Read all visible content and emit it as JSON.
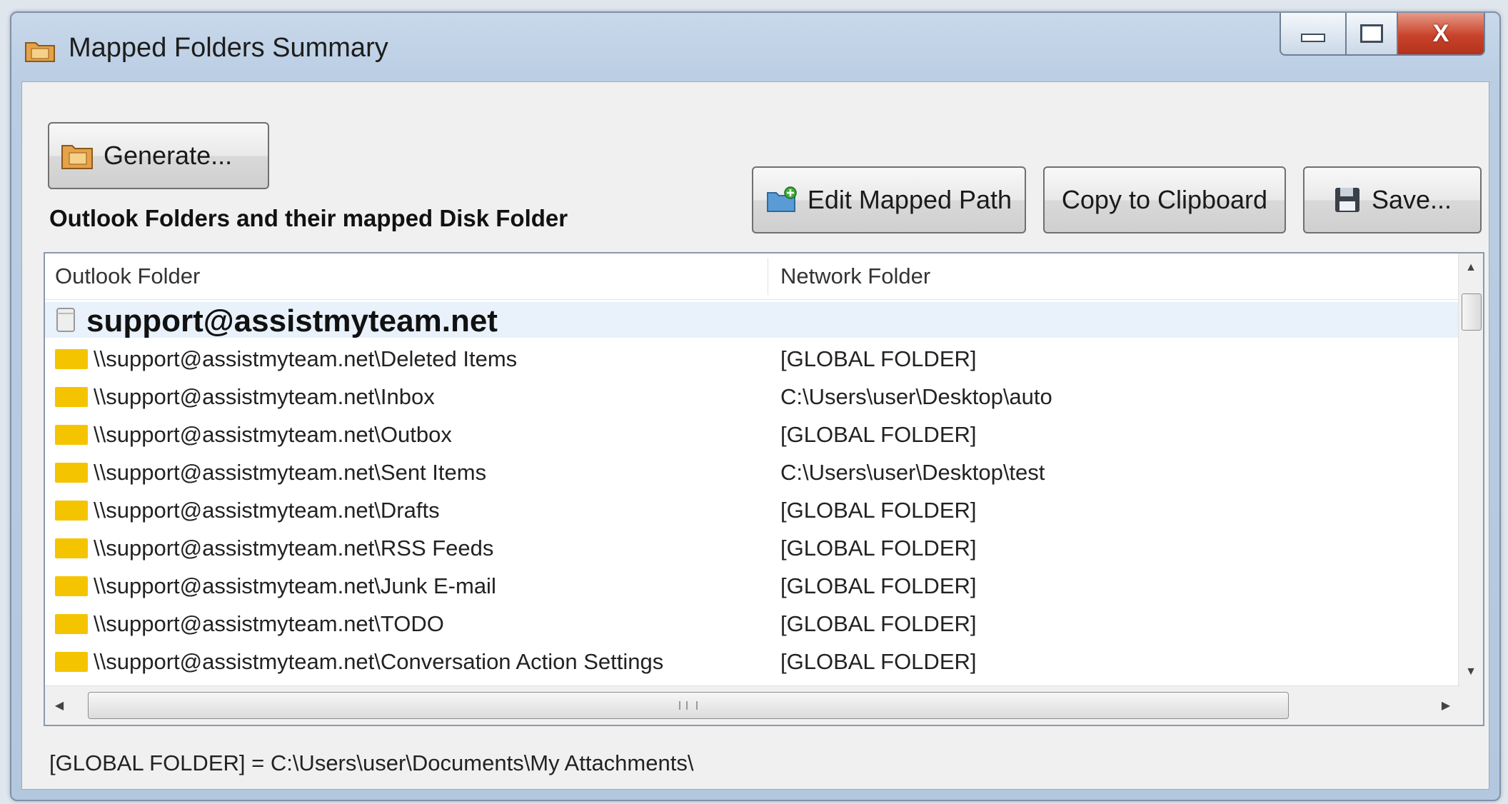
{
  "window": {
    "title": "Mapped Folders Summary",
    "icons": {
      "title": "folder-icon",
      "close": "close-icon",
      "minimize": "minimize-icon",
      "maximize": "maximize-icon"
    },
    "close_label": "X"
  },
  "toolbar": {
    "generate_label": "Generate...",
    "generate_icon": "folder-icon",
    "edit_label": "Edit Mapped Path",
    "edit_icon": "folder-add-icon",
    "copy_label": "Copy to Clipboard",
    "save_label": "Save...",
    "save_icon": "floppy-disk-icon"
  },
  "section_label": "Outlook Folders and their mapped Disk Folder",
  "list": {
    "columns": [
      "Outlook Folder",
      "Network Folder"
    ],
    "group": "support@assistmyteam.net",
    "rows": [
      {
        "outlook": "\\\\support@assistmyteam.net\\Deleted Items",
        "network": "[GLOBAL FOLDER]"
      },
      {
        "outlook": "\\\\support@assistmyteam.net\\Inbox",
        "network": "C:\\Users\\user\\Desktop\\auto"
      },
      {
        "outlook": "\\\\support@assistmyteam.net\\Outbox",
        "network": "[GLOBAL FOLDER]"
      },
      {
        "outlook": "\\\\support@assistmyteam.net\\Sent Items",
        "network": "C:\\Users\\user\\Desktop\\test"
      },
      {
        "outlook": "\\\\support@assistmyteam.net\\Drafts",
        "network": "[GLOBAL FOLDER]"
      },
      {
        "outlook": "\\\\support@assistmyteam.net\\RSS Feeds",
        "network": "[GLOBAL FOLDER]"
      },
      {
        "outlook": "\\\\support@assistmyteam.net\\Junk E-mail",
        "network": "[GLOBAL FOLDER]"
      },
      {
        "outlook": "\\\\support@assistmyteam.net\\TODO",
        "network": "[GLOBAL FOLDER]"
      },
      {
        "outlook": "\\\\support@assistmyteam.net\\Conversation Action Settings",
        "network": "[GLOBAL FOLDER]"
      }
    ]
  },
  "footer": "[GLOBAL FOLDER] = C:\\Users\\user\\Documents\\My Attachments\\",
  "colors": {
    "folder": "#f5c400",
    "titlebar": "#c9d8ea",
    "close_button": "#c9432a"
  }
}
